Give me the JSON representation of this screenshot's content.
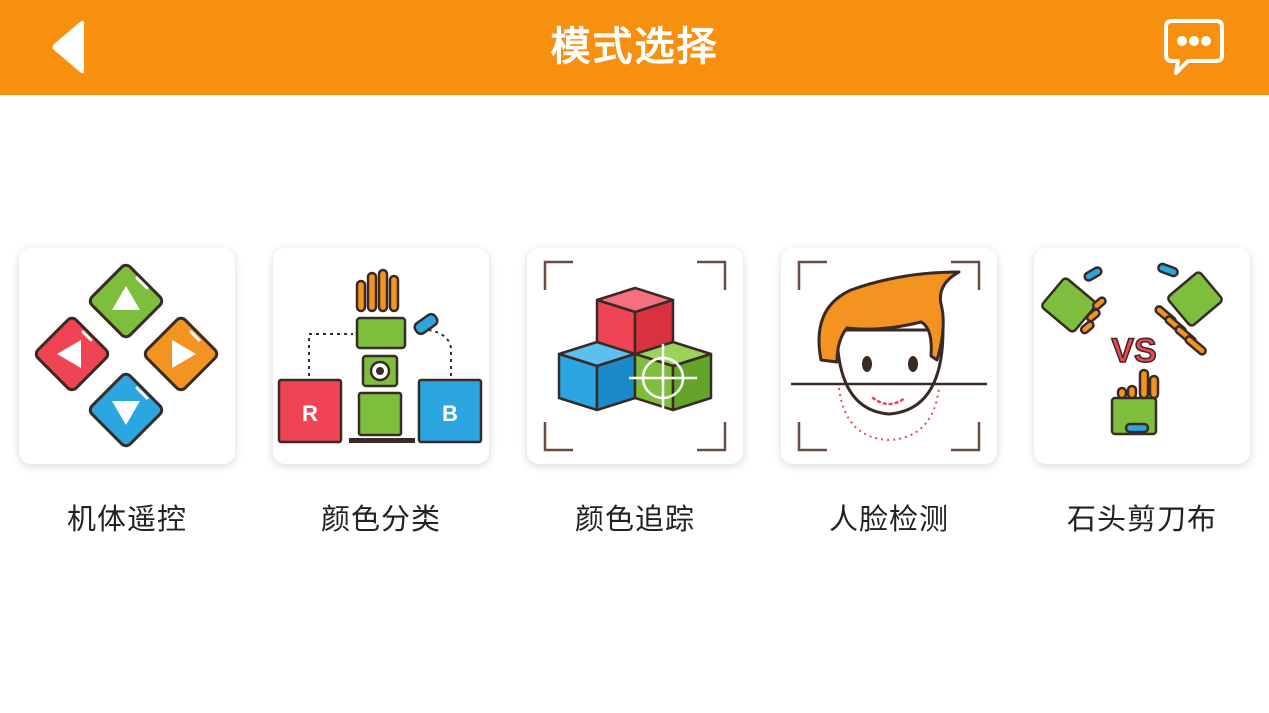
{
  "header": {
    "title": "模式选择",
    "back_icon": "back-arrow-icon",
    "message_icon": "chat-bubble-icon",
    "background": "#F7900E"
  },
  "modes": [
    {
      "label": "机体遥控",
      "icon": "direction-pad-icon"
    },
    {
      "label": "颜色分类",
      "icon": "color-sort-icon",
      "boxes": [
        "R",
        "B"
      ]
    },
    {
      "label": "颜色追踪",
      "icon": "color-track-icon"
    },
    {
      "label": "人脸检测",
      "icon": "face-detect-icon"
    },
    {
      "label": "石头剪刀布",
      "icon": "rock-paper-scissors-icon",
      "badge": "VS"
    }
  ],
  "colors": {
    "red": "#EF4454",
    "green": "#7DBF3C",
    "orange": "#F39422",
    "blue": "#2BA6E1",
    "outline": "#3A2A25"
  }
}
